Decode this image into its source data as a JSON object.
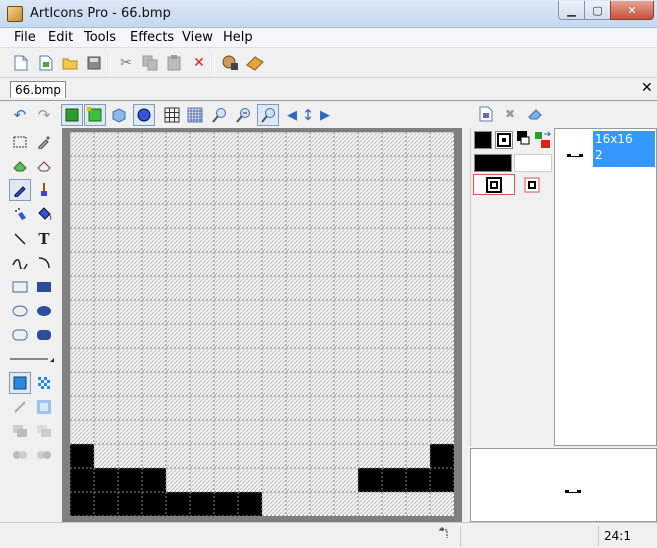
{
  "window": {
    "title": "ArtIcons Pro - 66.bmp"
  },
  "menu": [
    "File",
    "Edit",
    "Tools",
    "Effects",
    "View",
    "Help"
  ],
  "document": {
    "tab_label": "66.bmp"
  },
  "icon_list": {
    "selected_size": "16x16",
    "selected_depth": "2"
  },
  "status": {
    "zoom": "24:1"
  },
  "colors": {
    "accent": "#3399ff",
    "primary": "#000000",
    "secondary": "#ffffff"
  },
  "canvas": {
    "size": 16,
    "filled_pixels": [
      [
        13,
        0
      ],
      [
        13,
        15
      ],
      [
        14,
        0
      ],
      [
        14,
        1
      ],
      [
        14,
        2
      ],
      [
        14,
        3
      ],
      [
        14,
        12
      ],
      [
        14,
        13
      ],
      [
        14,
        14
      ],
      [
        14,
        15
      ],
      [
        15,
        0
      ],
      [
        15,
        1
      ],
      [
        15,
        2
      ],
      [
        15,
        3
      ],
      [
        15,
        4
      ],
      [
        15,
        5
      ],
      [
        15,
        6
      ],
      [
        15,
        7
      ]
    ]
  },
  "icons": {
    "main_toolbar": [
      "new-icon",
      "new-from-template-icon",
      "open-icon",
      "save-icon",
      "cut-icon",
      "copy-icon",
      "paste-icon",
      "delete-icon",
      "resources-icon",
      "help-book-icon"
    ],
    "editor_toolbar": [
      "undo-icon",
      "redo-icon",
      "green-frame-icon",
      "green-square-icon",
      "cube-icon",
      "preview-icon",
      "grid-icon",
      "fine-grid-icon",
      "zoom-in-icon",
      "zoom-out-icon",
      "zoom-fit-icon",
      "arrow-left-icon",
      "arrow-updown-icon",
      "arrow-right-icon"
    ]
  }
}
